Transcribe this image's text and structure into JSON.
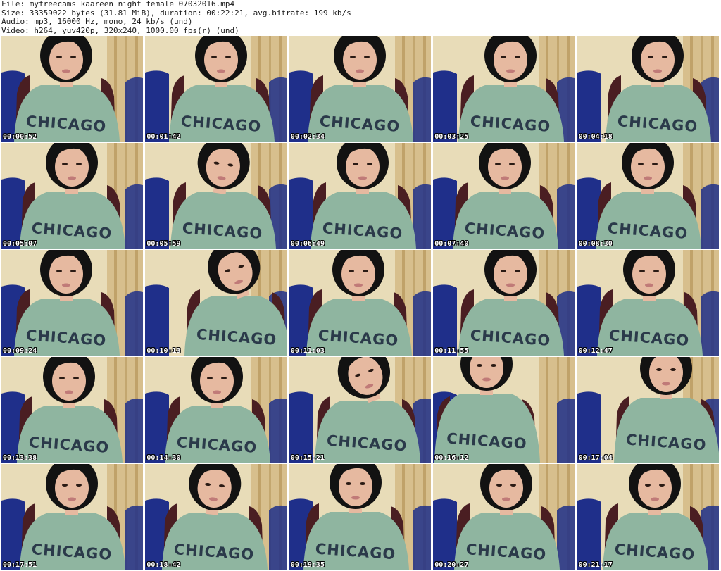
{
  "header": {
    "file": "File: myfreecams_kaareen_night_female_07032016.mp4",
    "size": "Size: 33359022 bytes (31.81 MiB), duration: 00:22:21, avg.bitrate: 199 kb/s",
    "audio": "Audio: mp3, 16000 Hz, mono, 24 kb/s (und)",
    "video": "Video: h264, yuv420p, 320x240, 1000.00 fps(r) (und)"
  },
  "shirt_text": "CHICAGO",
  "colors": {
    "wall": "#e8dcb8",
    "curtain": "#c9a86a",
    "sofa": "#1f2f8a",
    "shirt": "#8fb5a0",
    "hair": "#121212",
    "skin": "#e6b9a0",
    "chair": "#4a1e22"
  },
  "thumbnails": [
    {
      "time": "00:00:52"
    },
    {
      "time": "00:01:42"
    },
    {
      "time": "00:02:34"
    },
    {
      "time": "00:03:25"
    },
    {
      "time": "00:04:18"
    },
    {
      "time": "00:05:07"
    },
    {
      "time": "00:05:59"
    },
    {
      "time": "00:06:49"
    },
    {
      "time": "00:07:40"
    },
    {
      "time": "00:08:30"
    },
    {
      "time": "00:09:24"
    },
    {
      "time": "00:10:13"
    },
    {
      "time": "00:11:03"
    },
    {
      "time": "00:11:55"
    },
    {
      "time": "00:12:47"
    },
    {
      "time": "00:13:38"
    },
    {
      "time": "00:14:30"
    },
    {
      "time": "00:15:21"
    },
    {
      "time": "00:16:12"
    },
    {
      "time": "00:17:04"
    },
    {
      "time": "00:17:51"
    },
    {
      "time": "00:18:42"
    },
    {
      "time": "00:19:35"
    },
    {
      "time": "00:20:27"
    },
    {
      "time": "00:21:17"
    }
  ]
}
